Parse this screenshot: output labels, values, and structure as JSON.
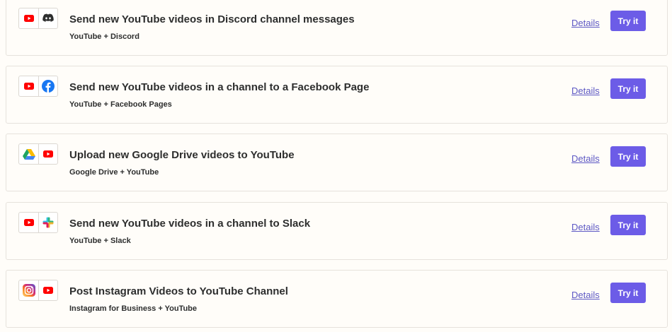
{
  "colors": {
    "try_button": "#6c5ce7",
    "details_link": "#5d58c4",
    "youtube_red": "#ff0000",
    "discord": "#5865f2",
    "facebook": "#1877f2"
  },
  "zaps": [
    {
      "title": "Send new YouTube videos in Discord channel messages",
      "apps": "YouTube + Discord",
      "icons": [
        "youtube-icon",
        "discord-icon"
      ],
      "details_label": "Details",
      "try_label": "Try it"
    },
    {
      "title": "Send new YouTube videos in a channel to a Facebook Page",
      "apps": "YouTube + Facebook Pages",
      "icons": [
        "youtube-icon",
        "facebook-icon"
      ],
      "details_label": "Details",
      "try_label": "Try it"
    },
    {
      "title": "Upload new Google Drive videos to YouTube",
      "apps": "Google Drive + YouTube",
      "icons": [
        "google-drive-icon",
        "youtube-icon"
      ],
      "details_label": "Details",
      "try_label": "Try it"
    },
    {
      "title": "Send new YouTube videos in a channel to Slack",
      "apps": "YouTube + Slack",
      "icons": [
        "youtube-icon",
        "slack-icon"
      ],
      "details_label": "Details",
      "try_label": "Try it"
    },
    {
      "title": "Post Instagram Videos to YouTube Channel",
      "apps": "Instagram for Business + YouTube",
      "icons": [
        "instagram-icon",
        "youtube-icon"
      ],
      "details_label": "Details",
      "try_label": "Try it"
    }
  ]
}
